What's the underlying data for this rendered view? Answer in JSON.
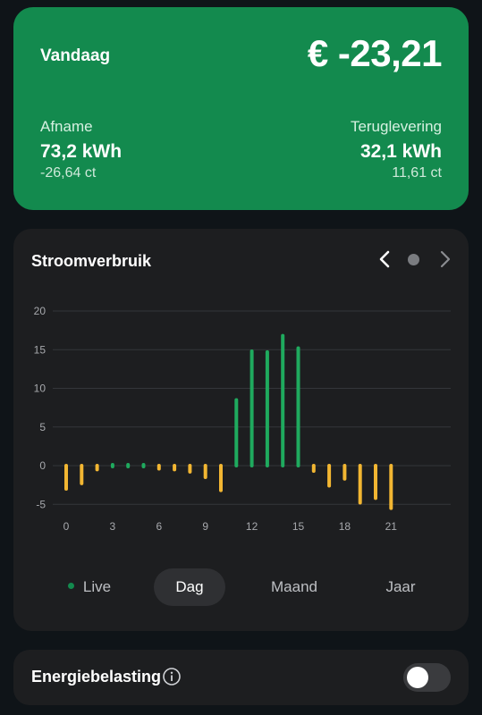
{
  "summary": {
    "title": "Vandaag",
    "total": "€ -23,21",
    "afname": {
      "label": "Afname",
      "value": "73,2 kWh",
      "cost": "-26,64 ct"
    },
    "teruglevering": {
      "label": "Teruglevering",
      "value": "32,1 kWh",
      "cost": "11,61 ct"
    }
  },
  "chart_card": {
    "title": "Stroomverbruik",
    "prev_icon": "chevron-left-icon",
    "next_icon": "chevron-right-icon"
  },
  "chart_data": {
    "type": "bar",
    "x_ticks": [
      "0",
      "3",
      "6",
      "9",
      "12",
      "15",
      "18",
      "21"
    ],
    "y_ticks": [
      "20",
      "15",
      "10",
      "5",
      "0",
      "-5"
    ],
    "ylim": [
      -5.5,
      20
    ],
    "x": [
      0,
      1,
      2,
      3,
      4,
      5,
      6,
      7,
      8,
      9,
      10,
      11,
      12,
      13,
      14,
      15,
      16,
      17,
      18,
      19,
      20,
      21
    ],
    "values": [
      -3.0,
      -2.3,
      -0.5,
      0,
      0,
      0,
      -0.4,
      -0.5,
      -0.8,
      -1.5,
      -3.2,
      8.5,
      14.8,
      14.7,
      16.8,
      15.2,
      -0.7,
      -2.6,
      -1.7,
      -4.8,
      -4.2,
      -5.5
    ],
    "colors": {
      "positive": "#1faa5e",
      "negative": "#f2b632"
    },
    "grid": true
  },
  "tabs": [
    {
      "label": "Live",
      "active": false
    },
    {
      "label": "Dag",
      "active": true
    },
    {
      "label": "Maand",
      "active": false
    },
    {
      "label": "Jaar",
      "active": false
    }
  ],
  "tax": {
    "label": "Energiebelasting",
    "info_icon": "info-icon",
    "toggle_on": false
  }
}
